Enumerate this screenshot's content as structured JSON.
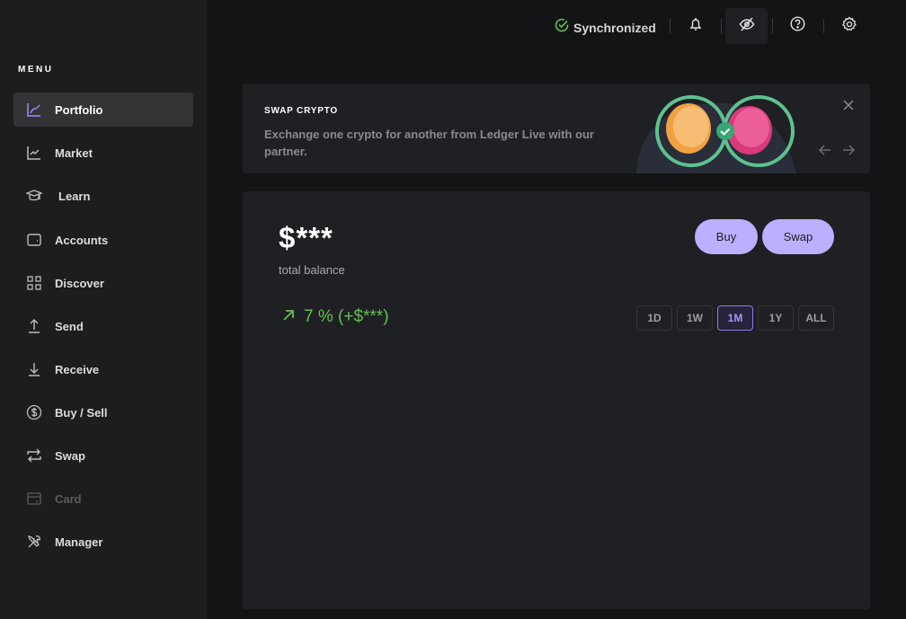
{
  "sidebar": {
    "menu_title": "MENU",
    "items": [
      {
        "label": "Portfolio",
        "icon": "portfolio-chart-icon",
        "active": true
      },
      {
        "label": "Market",
        "icon": "market-chart-icon"
      },
      {
        "label": "Learn",
        "icon": "graduation-cap-icon"
      },
      {
        "label": "Accounts",
        "icon": "wallet-icon"
      },
      {
        "label": "Discover",
        "icon": "grid-icon"
      },
      {
        "label": "Send",
        "icon": "arrow-up-icon"
      },
      {
        "label": "Receive",
        "icon": "arrow-down-icon"
      },
      {
        "label": "Buy / Sell",
        "icon": "dollar-circle-icon"
      },
      {
        "label": "Swap",
        "icon": "swap-arrows-icon"
      },
      {
        "label": "Card",
        "icon": "card-icon",
        "disabled": true
      },
      {
        "label": "Manager",
        "icon": "tools-icon"
      }
    ]
  },
  "topbar": {
    "sync_status": "Synchronized",
    "colors": {
      "sync": "#66be54"
    }
  },
  "banner": {
    "title": "SWAP CRYPTO",
    "description": "Exchange one crypto for another from Ledger Live with our partner."
  },
  "portfolio": {
    "balance": "$***",
    "balance_label": "total balance",
    "change": "7 % (+$***)",
    "buy_label": "Buy",
    "swap_label": "Swap",
    "ranges": [
      "1D",
      "1W",
      "1M",
      "1Y",
      "ALL"
    ],
    "selected_range": "1M",
    "colors": {
      "accent": "#bbb0ff",
      "positive": "#66be54"
    }
  }
}
